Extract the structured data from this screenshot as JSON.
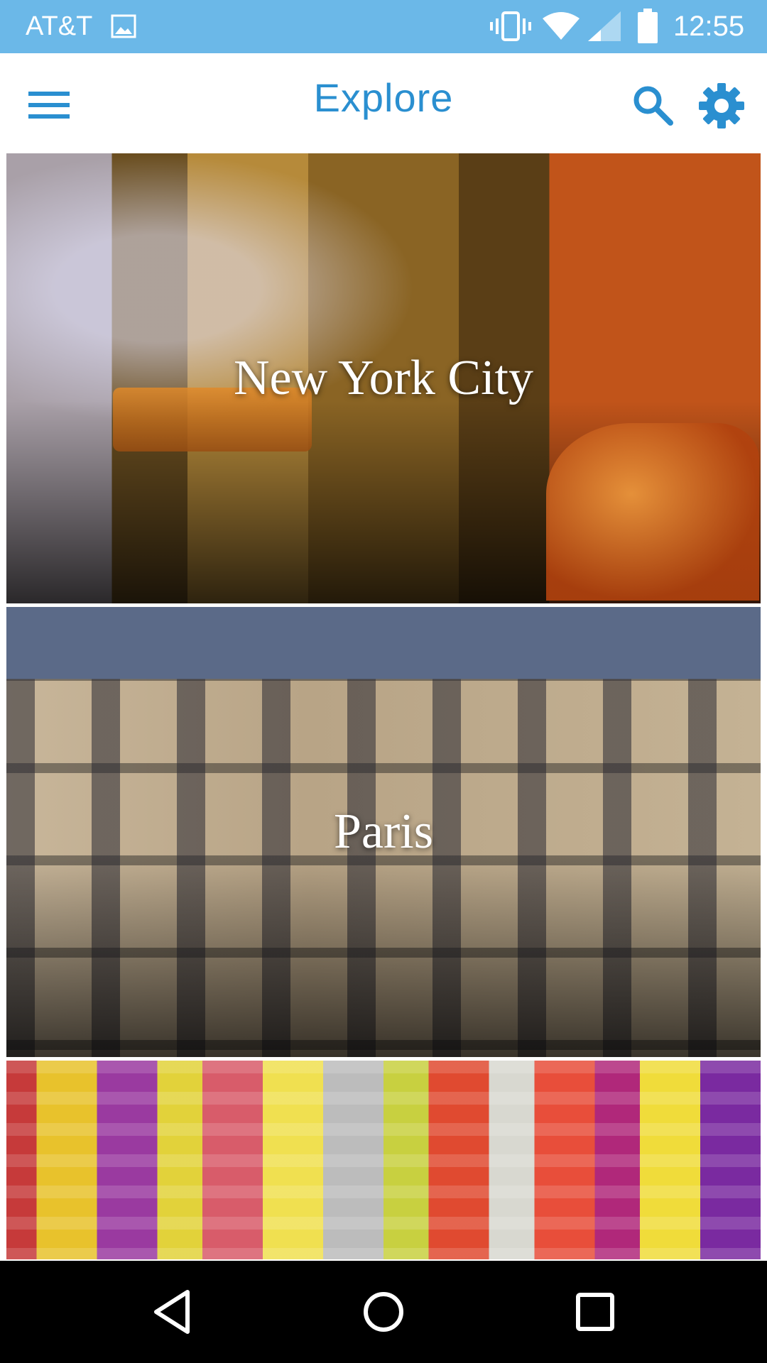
{
  "status_bar": {
    "carrier": "AT&T",
    "time": "12:55",
    "icons": [
      "gallery-icon",
      "vibrate-icon",
      "wifi-icon",
      "signal-icon",
      "battery-icon"
    ]
  },
  "app_bar": {
    "title": "Explore",
    "menu_icon": "hamburger-menu-icon",
    "search_icon": "search-icon",
    "settings_icon": "gear-icon",
    "accent_color": "#2a8fd0"
  },
  "destinations": [
    {
      "name": "New York City"
    },
    {
      "name": "Paris"
    },
    {
      "name": ""
    }
  ],
  "nav_bar": {
    "icons": [
      "back-icon",
      "home-icon",
      "recents-icon"
    ]
  },
  "colors": {
    "status_bar": "#6bb8e8",
    "nav_bar": "#000000"
  }
}
